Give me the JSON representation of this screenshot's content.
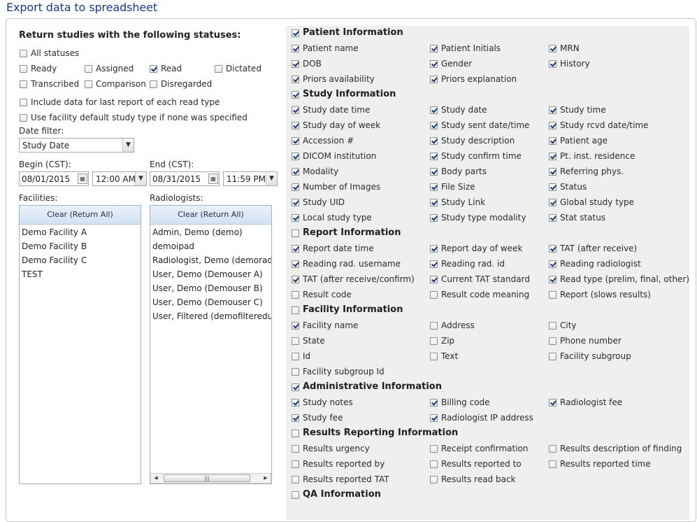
{
  "page": {
    "title": "Export data to spreadsheet"
  },
  "left": {
    "heading": "Return studies with the following statuses:",
    "statuses": {
      "all": {
        "label": "All statuses",
        "checked": false
      },
      "ready": {
        "label": "Ready",
        "checked": false
      },
      "assigned": {
        "label": "Assigned",
        "checked": false
      },
      "read": {
        "label": "Read",
        "checked": true
      },
      "dictated": {
        "label": "Dictated",
        "checked": false
      },
      "transcribed": {
        "label": "Transcribed",
        "checked": false
      },
      "comparison": {
        "label": "Comparison",
        "checked": false
      },
      "disregarded": {
        "label": "Disregarded",
        "checked": false
      }
    },
    "options": {
      "last_report": {
        "label": "Include data for last report of each read type",
        "checked": false
      },
      "facility_default": {
        "label": "Use facility default study type if none was specified",
        "checked": false
      }
    },
    "date_filter": {
      "label": "Date filter:",
      "value": "Study Date"
    },
    "begin": {
      "label": "Begin (CST):",
      "date": "08/01/2015",
      "time": "12:00 AM"
    },
    "end": {
      "label": "End (CST):",
      "date": "08/31/2015",
      "time": "11:59 PM"
    },
    "facilities": {
      "label": "Facilities:",
      "clear": "Clear (Return All)",
      "items": [
        "Demo Facility A",
        "Demo Facility B",
        "Demo Facility C",
        "TEST"
      ]
    },
    "radiologists": {
      "label": "Radiologists:",
      "clear": "Clear (Return All)",
      "items": [
        "Admin, Demo (demo)",
        "demoipad",
        "Radiologist, Demo (demorad)",
        "User, Demo (Demouser A)",
        "User, Demo (Demouser B)",
        "User, Demo (Demouser C)",
        "User, Filtered (demofiltereduse"
      ]
    }
  },
  "sections": [
    {
      "title": "Patient Information",
      "checked": true,
      "rows": [
        [
          {
            "label": "Patient name",
            "checked": true
          },
          {
            "label": "Patient Initials",
            "checked": true
          },
          {
            "label": "MRN",
            "checked": true
          }
        ],
        [
          {
            "label": "DOB",
            "checked": true
          },
          {
            "label": "Gender",
            "checked": true
          },
          {
            "label": "History",
            "checked": true
          }
        ],
        [
          {
            "label": "Priors availability",
            "checked": true
          },
          {
            "label": "Priors explanation",
            "checked": true
          }
        ]
      ]
    },
    {
      "title": "Study Information",
      "checked": true,
      "rows": [
        [
          {
            "label": "Study date time",
            "checked": true
          },
          {
            "label": "Study date",
            "checked": true
          },
          {
            "label": "Study time",
            "checked": true
          }
        ],
        [
          {
            "label": "Study day of week",
            "checked": true
          },
          {
            "label": "Study sent date/time",
            "checked": true
          },
          {
            "label": "Study rcvd date/time",
            "checked": true
          }
        ],
        [
          {
            "label": "Accession #",
            "checked": true
          },
          {
            "label": "Study description",
            "checked": true
          },
          {
            "label": "Patient age",
            "checked": true
          }
        ],
        [
          {
            "label": "DICOM institution",
            "checked": true
          },
          {
            "label": "Study confirm time",
            "checked": true
          },
          {
            "label": "Pt. inst. residence",
            "checked": true
          }
        ],
        [
          {
            "label": "Modality",
            "checked": true
          },
          {
            "label": "Body parts",
            "checked": true
          },
          {
            "label": "Referring phys.",
            "checked": true
          }
        ],
        [
          {
            "label": "Number of Images",
            "checked": true
          },
          {
            "label": "File Size",
            "checked": true
          },
          {
            "label": "Status",
            "checked": true
          }
        ],
        [
          {
            "label": "Study UID",
            "checked": true
          },
          {
            "label": "Study Link",
            "checked": true
          },
          {
            "label": "Global study type",
            "checked": true
          }
        ],
        [
          {
            "label": "Local study type",
            "checked": true
          },
          {
            "label": "Study type modality",
            "checked": true
          },
          {
            "label": "Stat status",
            "checked": true
          }
        ]
      ]
    },
    {
      "title": "Report Information",
      "checked": false,
      "rows": [
        [
          {
            "label": "Report date time",
            "checked": true
          },
          {
            "label": "Report day of week",
            "checked": true
          },
          {
            "label": "TAT (after receive)",
            "checked": true
          }
        ],
        [
          {
            "label": "Reading rad. username",
            "checked": true
          },
          {
            "label": "Reading rad. id",
            "checked": true
          },
          {
            "label": "Reading radiologist",
            "checked": true
          }
        ],
        [
          {
            "label": "TAT (after receive/confirm)",
            "checked": true
          },
          {
            "label": "Current TAT standard",
            "checked": true
          },
          {
            "label": "Read type (prelim, final, other)",
            "checked": true
          }
        ],
        [
          {
            "label": "Result code",
            "checked": false
          },
          {
            "label": "Result code meaning",
            "checked": false
          },
          {
            "label": "Report (slows results)",
            "checked": false
          }
        ]
      ]
    },
    {
      "title": "Facility Information",
      "checked": false,
      "rows": [
        [
          {
            "label": "Facility name",
            "checked": true
          },
          {
            "label": "Address",
            "checked": false
          },
          {
            "label": "City",
            "checked": false
          }
        ],
        [
          {
            "label": "State",
            "checked": false
          },
          {
            "label": "Zip",
            "checked": false
          },
          {
            "label": "Phone number",
            "checked": false
          }
        ],
        [
          {
            "label": "Id",
            "checked": false
          },
          {
            "label": "Text",
            "checked": false
          },
          {
            "label": "Facility subgroup",
            "checked": false
          }
        ],
        [
          {
            "label": "Facility subgroup Id",
            "checked": false
          }
        ]
      ]
    },
    {
      "title": "Administrative Information",
      "checked": true,
      "rows": [
        [
          {
            "label": "Study notes",
            "checked": true
          },
          {
            "label": "Billing code",
            "checked": true
          },
          {
            "label": "Radiologist fee",
            "checked": true
          }
        ],
        [
          {
            "label": "Study fee",
            "checked": true
          },
          {
            "label": "Radiologist IP address",
            "checked": true
          }
        ]
      ]
    },
    {
      "title": "Results Reporting Information",
      "checked": false,
      "rows": [
        [
          {
            "label": "Results urgency",
            "checked": false
          },
          {
            "label": "Receipt confirmation",
            "checked": false
          },
          {
            "label": "Results description of finding",
            "checked": false
          }
        ],
        [
          {
            "label": "Results reported by",
            "checked": false
          },
          {
            "label": "Results reported to",
            "checked": false
          },
          {
            "label": "Results reported time",
            "checked": false
          }
        ],
        [
          {
            "label": "Results reported TAT",
            "checked": false
          },
          {
            "label": "Results read back",
            "checked": false
          }
        ]
      ]
    },
    {
      "title": "QA Information",
      "checked": false,
      "rows": []
    }
  ]
}
